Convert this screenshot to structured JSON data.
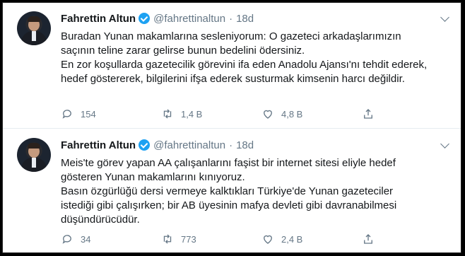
{
  "tweets": [
    {
      "name": "Fahrettin Altun",
      "handle": "@fahrettinaltun",
      "separator": "·",
      "time": "18d",
      "paragraphs": [
        "Buradan Yunan makamlarına sesleniyorum: O gazeteci arkadaşlarımızın saçının teline zarar gelirse bunun bedelini ödersiniz.",
        "En zor koşullarda gazetecilik görevini ifa eden Anadolu Ajansı'nı tehdit ederek, hedef göstererek, bilgilerini ifşa ederek susturmak kimsenin harcı değildir."
      ],
      "replies": "154",
      "retweets": "1,4 B",
      "likes": "4,8 B"
    },
    {
      "name": "Fahrettin Altun",
      "handle": "@fahrettinaltun",
      "separator": "·",
      "time": "18d",
      "paragraphs": [
        "Meis'te görev yapan AA çalışanlarını faşist bir internet sitesi eliyle hedef gösteren Yunan makamlarını kınıyoruz.",
        "Basın özgürlüğü dersi vermeye kalktıkları Türkiye'de Yunan gazeteciler istediği gibi çalışırken; bir AB üyesinin mafya devleti gibi davranabilmesi düşündürücüdür."
      ],
      "replies": "34",
      "retweets": "773",
      "likes": "2,4 B"
    }
  ],
  "icons": {
    "verified": "verified-badge-icon",
    "caret": "chevron-down-icon",
    "reply": "reply-icon",
    "retweet": "retweet-icon",
    "like": "heart-icon",
    "share": "share-icon"
  },
  "colors": {
    "text": "#14171a",
    "secondary": "#657786",
    "verified": "#1da1f2",
    "divider": "#e6ecf0"
  }
}
